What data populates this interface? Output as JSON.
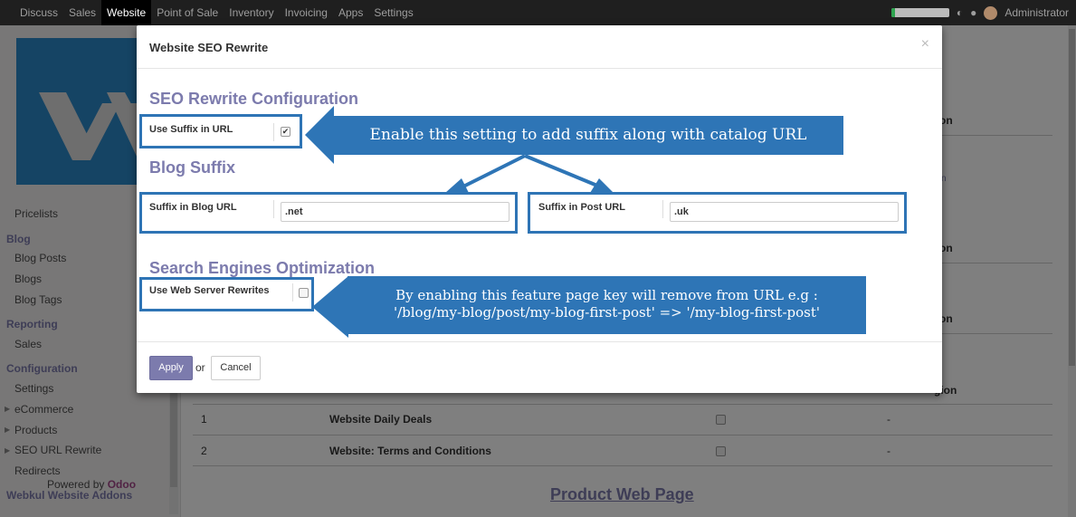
{
  "topbar": {
    "menu": [
      "Discuss",
      "Sales",
      "Website",
      "Point of Sale",
      "Inventory",
      "Invoicing",
      "Apps",
      "Settings"
    ],
    "active": "Website",
    "user": "Administrator"
  },
  "sidebar": {
    "pricelists": "Pricelists",
    "blog_header": "Blog",
    "blog_posts": "Blog Posts",
    "blogs": "Blogs",
    "blog_tags": "Blog Tags",
    "reporting_header": "Reporting",
    "sales": "Sales",
    "configuration_header": "Configuration",
    "settings": "Settings",
    "ecommerce": "eCommerce",
    "products": "Products",
    "seo_url_rewrite": "SEO URL Rewrite",
    "redirects": "Redirects",
    "addons_header": "Webkul Website Addons",
    "powered_by": "Powered by",
    "odoo": "Odoo"
  },
  "background": {
    "col_partial_1": "on",
    "col_partial_2": "n",
    "col_partial_3": "on",
    "col_partial_4": "on",
    "col_partial_5": "gion",
    "rows": [
      {
        "seq": "1",
        "name": "Website Daily Deals",
        "dash": "-"
      },
      {
        "seq": "2",
        "name": "Website: Terms and Conditions",
        "dash": "-"
      }
    ],
    "page_link": "Product Web Page"
  },
  "modal": {
    "title": "Website SEO Rewrite",
    "close": "×",
    "seo_config_title": "SEO Rewrite Configuration",
    "use_suffix_label": "Use Suffix in URL",
    "use_suffix_checked": true,
    "blog_suffix_title": "Blog Suffix",
    "blog_url_label": "Suffix in Blog URL",
    "blog_url_value": ".net",
    "post_url_label": "Suffix in Post URL",
    "post_url_value": ".uk",
    "seo_title": "Search Engines Optimization",
    "web_server_label": "Use Web Server Rewrites",
    "web_server_checked": false,
    "apply": "Apply",
    "or": "or",
    "cancel": "Cancel"
  },
  "callouts": {
    "suffix_note": "Enable this setting to add suffix along with catalog URL",
    "rewrite_note_line1": "By enabling this feature page key will remove from URL e.g :",
    "rewrite_note_line2": "'/blog/my-blog/post/my-blog-first-post' => '/my-blog-first-post'"
  },
  "colors": {
    "accent": "#7c7bad",
    "callout": "#2e75b6",
    "highlight": "#2e74b5"
  }
}
